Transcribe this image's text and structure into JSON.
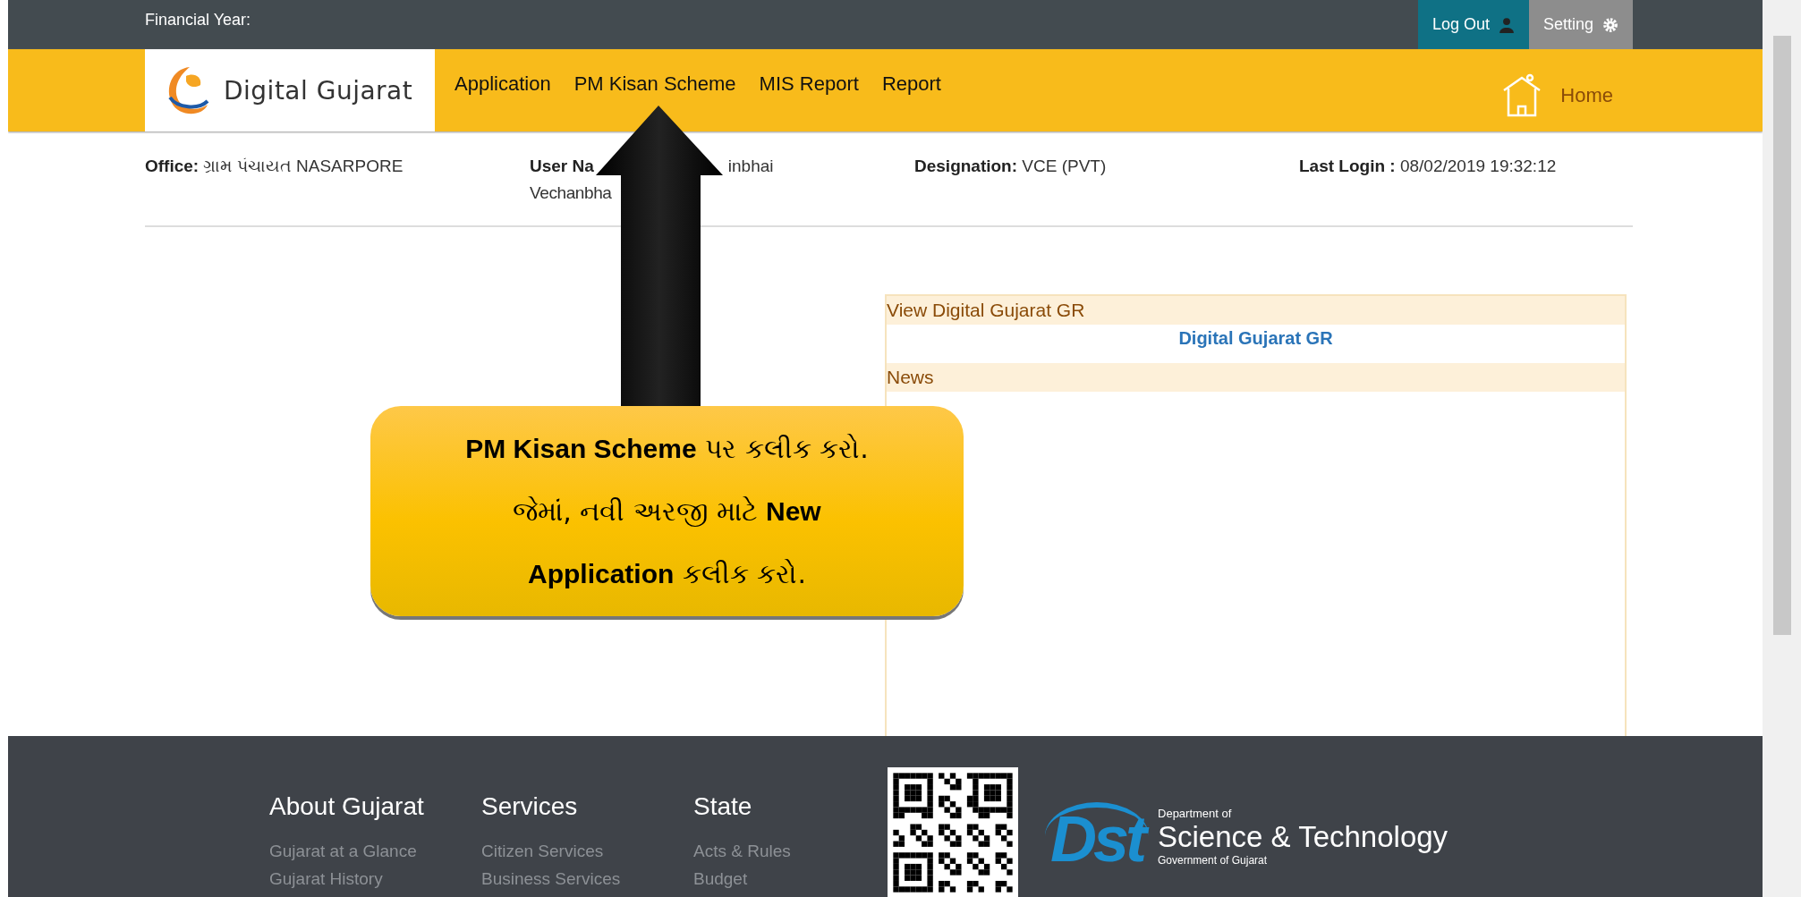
{
  "top_bar": {
    "financial_year_label": "Financial Year:",
    "buttons": [
      {
        "label": "Log Out",
        "kind": "logout"
      },
      {
        "label": "Setting",
        "kind": "setting"
      }
    ]
  },
  "nav": {
    "logo_text": "Digital Gujarat",
    "menu": [
      "Application",
      "PM Kisan Scheme",
      "MIS Report",
      "Report"
    ],
    "home": "Home"
  },
  "info": {
    "office_label": "Office:",
    "office_value": "ગ્રામ પંચાયત NASARPORE",
    "user_label": "User Na",
    "user_value_1": "inbhai",
    "user_value_2": "Vechanbha",
    "designation_label": "Designation:",
    "designation_value": "VCE (PVT)",
    "last_login_label": "Last Login :",
    "last_login_value": "08/02/2019 19:32:12"
  },
  "panel": {
    "gr_header": "View Digital Gujarat GR",
    "gr_link": "Digital Gujarat GR",
    "news_header": "News"
  },
  "callout": {
    "lines": [
      "**PM Kisan Scheme** પર કલીક કરો.",
      "જેમાં, નવી અરજી માટે **New**",
      "**Application** કલીક કરો."
    ]
  },
  "footer": {
    "columns": [
      {
        "title": "About Gujarat",
        "links": [
          "Gujarat at a Glance",
          "Gujarat History"
        ]
      },
      {
        "title": "Services",
        "links": [
          "Citizen Services",
          "Business Services"
        ]
      },
      {
        "title": "State",
        "links": [
          "Acts & Rules",
          "Budget"
        ]
      }
    ],
    "dst": {
      "mark": "Dst",
      "line_1": "Department of",
      "line_2": "Science & Technology",
      "line_3": "Government of Gujarat"
    }
  }
}
